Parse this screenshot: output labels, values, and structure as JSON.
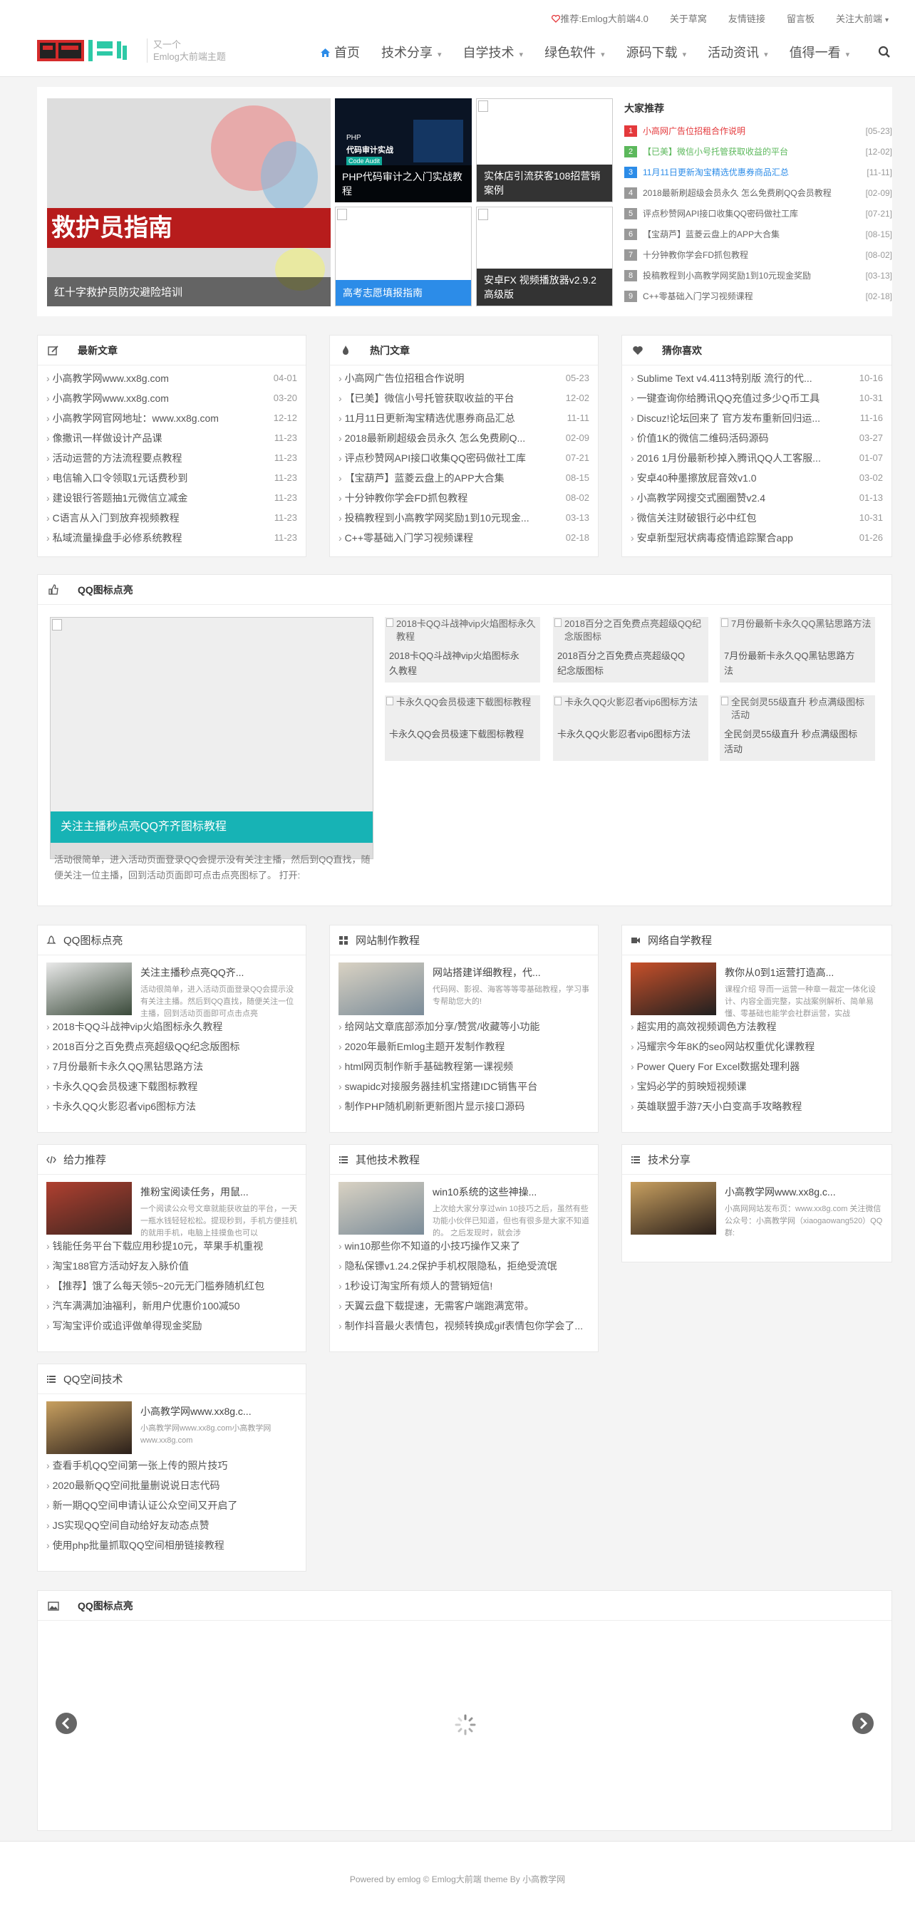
{
  "topbar": {
    "promo": "推荐:Emlog大前端4.0",
    "links": [
      "关于草窝",
      "友情链接",
      "留言板",
      "关注大前端"
    ]
  },
  "header": {
    "tagline_1": "又一个",
    "tagline_2": "Emlog大前端主题",
    "nav": [
      "首页",
      "技术分享",
      "自学技术",
      "绿色软件",
      "源码下载",
      "活动资讯",
      "值得一看"
    ]
  },
  "slider": {
    "main_image_text": "救护员指南",
    "main_caption": "红十字救护员防灾避险培训"
  },
  "grid": [
    {
      "caption": "PHP代码审计之入门实战教程",
      "img_text_1": "PHP",
      "img_text_2": "代码审计实战",
      "img_text_3": "Code Audit"
    },
    {
      "caption": "实体店引流获客108招营销案例"
    },
    {
      "caption": "高考志愿填报指南"
    },
    {
      "caption": "安卓FX 视频播放器v2.9.2高级版"
    }
  ],
  "recommend": {
    "title": "大家推荐",
    "items": [
      {
        "n": "1",
        "t": "小高网广告位招租合作说明",
        "d": "[05-23]",
        "color": "#e4393c"
      },
      {
        "n": "2",
        "t": "【已美】微信小号托管获取收益的平台",
        "d": "[12-02]",
        "color": "#5cb85c"
      },
      {
        "n": "3",
        "t": "11月11日更新淘宝精选优惠券商品汇总",
        "d": "[11-11]",
        "color": "#2c8ce8"
      },
      {
        "n": "4",
        "t": "2018最新刷超级会员永久 怎么免费刷QQ会员教程",
        "d": "[02-09]",
        "color": ""
      },
      {
        "n": "5",
        "t": "评点秒赞网API接口收集QQ密码做社工库",
        "d": "[07-21]",
        "color": ""
      },
      {
        "n": "6",
        "t": "【宝葫芦】蓝菱云盘上的APP大合集",
        "d": "[08-15]",
        "color": ""
      },
      {
        "n": "7",
        "t": "十分钟教你学会FD抓包教程",
        "d": "[08-02]",
        "color": ""
      },
      {
        "n": "8",
        "t": "投稿教程到小高教学网奖励1到10元现金奖励",
        "d": "[03-13]",
        "color": ""
      },
      {
        "n": "9",
        "t": "C++零基础入门学习视频课程",
        "d": "[02-18]",
        "color": ""
      }
    ]
  },
  "latest": {
    "title": "最新文章",
    "items": [
      {
        "t": "小高教学网www.xx8g.com",
        "d": "04-01"
      },
      {
        "t": "小高教学网www.xx8g.com",
        "d": "03-20"
      },
      {
        "t": "小高教学网官网地址：www.xx8g.com",
        "d": "12-12"
      },
      {
        "t": "像撒讯一样做设计产品课",
        "d": "11-23"
      },
      {
        "t": "活动运营的方法流程要点教程",
        "d": "11-23"
      },
      {
        "t": "电信输入口令领取1元话费秒到",
        "d": "11-23"
      },
      {
        "t": "建设银行答题抽1元微信立减金",
        "d": "11-23"
      },
      {
        "t": "C语言从入门到放弃视频教程",
        "d": "11-23"
      },
      {
        "t": "私域流量操盘手必修系统教程",
        "d": "11-23"
      }
    ]
  },
  "hot": {
    "title": "热门文章",
    "items": [
      {
        "t": "小高网广告位招租合作说明",
        "d": "05-23"
      },
      {
        "t": "【已美】微信小号托管获取收益的平台",
        "d": "12-02"
      },
      {
        "t": "11月11日更新淘宝精选优惠券商品汇总",
        "d": "11-11"
      },
      {
        "t": "2018最新刷超级会员永久 怎么免费刷Q...",
        "d": "02-09"
      },
      {
        "t": "评点秒赞网API接口收集QQ密码做社工库",
        "d": "07-21"
      },
      {
        "t": "【宝葫芦】蓝菱云盘上的APP大合集",
        "d": "08-15"
      },
      {
        "t": "十分钟教你学会FD抓包教程",
        "d": "08-02"
      },
      {
        "t": "投稿教程到小高教学网奖励1到10元现金...",
        "d": "03-13"
      },
      {
        "t": "C++零基础入门学习视频课程",
        "d": "02-18"
      }
    ]
  },
  "guess": {
    "title": "猜你喜欢",
    "items": [
      {
        "t": "Sublime Text v4.4113特别版 流行的代...",
        "d": "10-16"
      },
      {
        "t": "一键查询你给腾讯QQ充值过多少Q币工具",
        "d": "10-31"
      },
      {
        "t": "Discuz!论坛回来了 官方发布重新回归运...",
        "d": "11-16"
      },
      {
        "t": "价值1K的微信二维码活码源码",
        "d": "03-27"
      },
      {
        "t": "2016 1月份最新秒掉入腾讯QQ人工客服...",
        "d": "01-07"
      },
      {
        "t": "安卓40种墨擦放屁音效v1.0",
        "d": "03-02"
      },
      {
        "t": "小高教学网搜交式圈圈赞v2.4",
        "d": "01-13"
      },
      {
        "t": "微信关注财破银行必中红包",
        "d": "10-31"
      },
      {
        "t": "安卓新型冠状病毒疫情追踪聚合app",
        "d": "01-26"
      }
    ]
  },
  "qqicon": {
    "title": "QQ图标点亮",
    "big_caption": "关注主播秒点亮QQ齐齐图标教程",
    "big_desc": "活动很简单，进入活动页面登录QQ会提示没有关注主播，然后到QQ直找，随便关注一位主播，回到活动页面即可点击点亮图标了。 打开:",
    "thumbs": [
      {
        "alt": "2018卡QQ斗战神vip火焰图标永久教程",
        "t": "2018卡QQ斗战神vip火焰图标永久教程"
      },
      {
        "alt": "2018百分之百免费点亮超级QQ纪念版图标",
        "t": "2018百分之百免费点亮超级QQ纪念版图标"
      },
      {
        "alt": "7月份最新卡永久QQ黑钻思路方法",
        "t": "7月份最新卡永久QQ黑钻思路方法"
      },
      {
        "alt": "卡永久QQ会员极速下载图标教程",
        "t": "卡永久QQ会员极速下载图标教程"
      },
      {
        "alt": "卡永久QQ火影忍者vip6图标方法",
        "t": "卡永久QQ火影忍者vip6图标方法"
      },
      {
        "alt": "全民剑灵55级直升 秒点满级图标活动",
        "t": "全民剑灵55级直升 秒点满级图标活动"
      }
    ]
  },
  "cats": [
    {
      "title": "QQ图标点亮",
      "ftitle": "关注主播秒点亮QQ齐...",
      "fdesc": "活动很简单，进入活动页面登录QQ会提示没有关注主播。然后到QQ直找，随便关注一位主播，回到活动页面即可点击点亮",
      "items": [
        "2018卡QQ斗战神vip火焰图标永久教程",
        "2018百分之百免费点亮超级QQ纪念版图标",
        "7月份最新卡永久QQ黑钻思路方法",
        "卡永久QQ会员极速下载图标教程",
        "卡永久QQ火影忍者vip6图标方法"
      ]
    },
    {
      "title": "网站制作教程",
      "ftitle": "网站搭建详细教程，代...",
      "fdesc": "代码网、影视、海客等等零基础教程，学习事专帮助您大的!",
      "items": [
        "给网站文章底部添加分享/赞赏/收藏等小功能",
        "2020年最新Emlog主题开发制作教程",
        "html网页制作新手基础教程第一课视频",
        "swapidc对接服务器挂机宝搭建IDC销售平台",
        "制作PHP随机刷新更新图片显示接口源码"
      ]
    },
    {
      "title": "网络自学教程",
      "ftitle": "教你从0到1运营打造高...",
      "fdesc": "课程介绍 导而一运营一种章一裁定一体化设计、内容全面完整，实战案例解析、简单易懂、零基础也能学会社群运营，实战",
      "items": [
        "超实用的高效视频调色方法教程",
        "冯耀宗今年8K的seo网站权重优化课教程",
        "Power Query For Excel数据处理利器",
        "宝妈必学的剪映短视频课",
        "英雄联盟手游7天小白变高手攻略教程"
      ]
    },
    {
      "title": "给力推荐",
      "ftitle": "推粉宝阅读任务，用鼠...",
      "fdesc": "一个阅读公众号文章就能获收益的平台，一天一瓶水钱轻轻松松。提现秒到，手机方便挂机的就用手机，电脑上挂摸鱼也可以",
      "items": [
        "钱能任务平台下载应用秒提10元，苹果手机重视",
        "淘宝188官方活动好友入脉价值",
        "【推荐】饿了么每天领5~20元无门槛券随机红包",
        "汽车满满加油福利，新用户优惠价100减50",
        "写淘宝评价或追评做单得现金奖励"
      ]
    },
    {
      "title": "其他技术教程",
      "ftitle": "win10系统的这些神操...",
      "fdesc": "上次给大家分享过win 10技巧之后，虽然有些功能小伙伴已知道，但也有很多是大家不知道的。 之后发现时，就会涉",
      "items": [
        "win10那些你不知道的小技巧操作又来了",
        "隐私保镖v1.24.2保护手机权限隐私，拒绝受流氓",
        "1秒设订淘宝所有烦人的营销短信!",
        "天翼云盘下载提速，无需客户端跑满宽带。",
        "制作抖音最火表情包，视频转换成gif表情包你学会了..."
      ]
    },
    {
      "title": "技术分享",
      "ftitle": "小高教学网www.xx8g.c...",
      "fdesc": "小高网网站发布页：www.xx8g.com 关注微信公众号：小高教学网（xiaogaowang520）QQ群:",
      "items": []
    },
    {
      "title": "QQ空间技术",
      "ftitle": "小高教学网www.xx8g.c...",
      "fdesc": "小高教学网www.xx8g.com小高教学网www.xx8g.com",
      "items": [
        "查看手机QQ空间第一张上传的照片技巧",
        "2020最新QQ空间批量删说说日志代码",
        "新一期QQ空间申请认证公众空间又开启了",
        "JS实现QQ空间自动给好友动态点赞",
        "使用php批量抓取QQ空间相册链接教程"
      ]
    }
  ],
  "carousel": {
    "title": "QQ图标点亮"
  },
  "footer": {
    "text": "Powered by emlog © Emlog大前端 theme By 小高教学网"
  }
}
